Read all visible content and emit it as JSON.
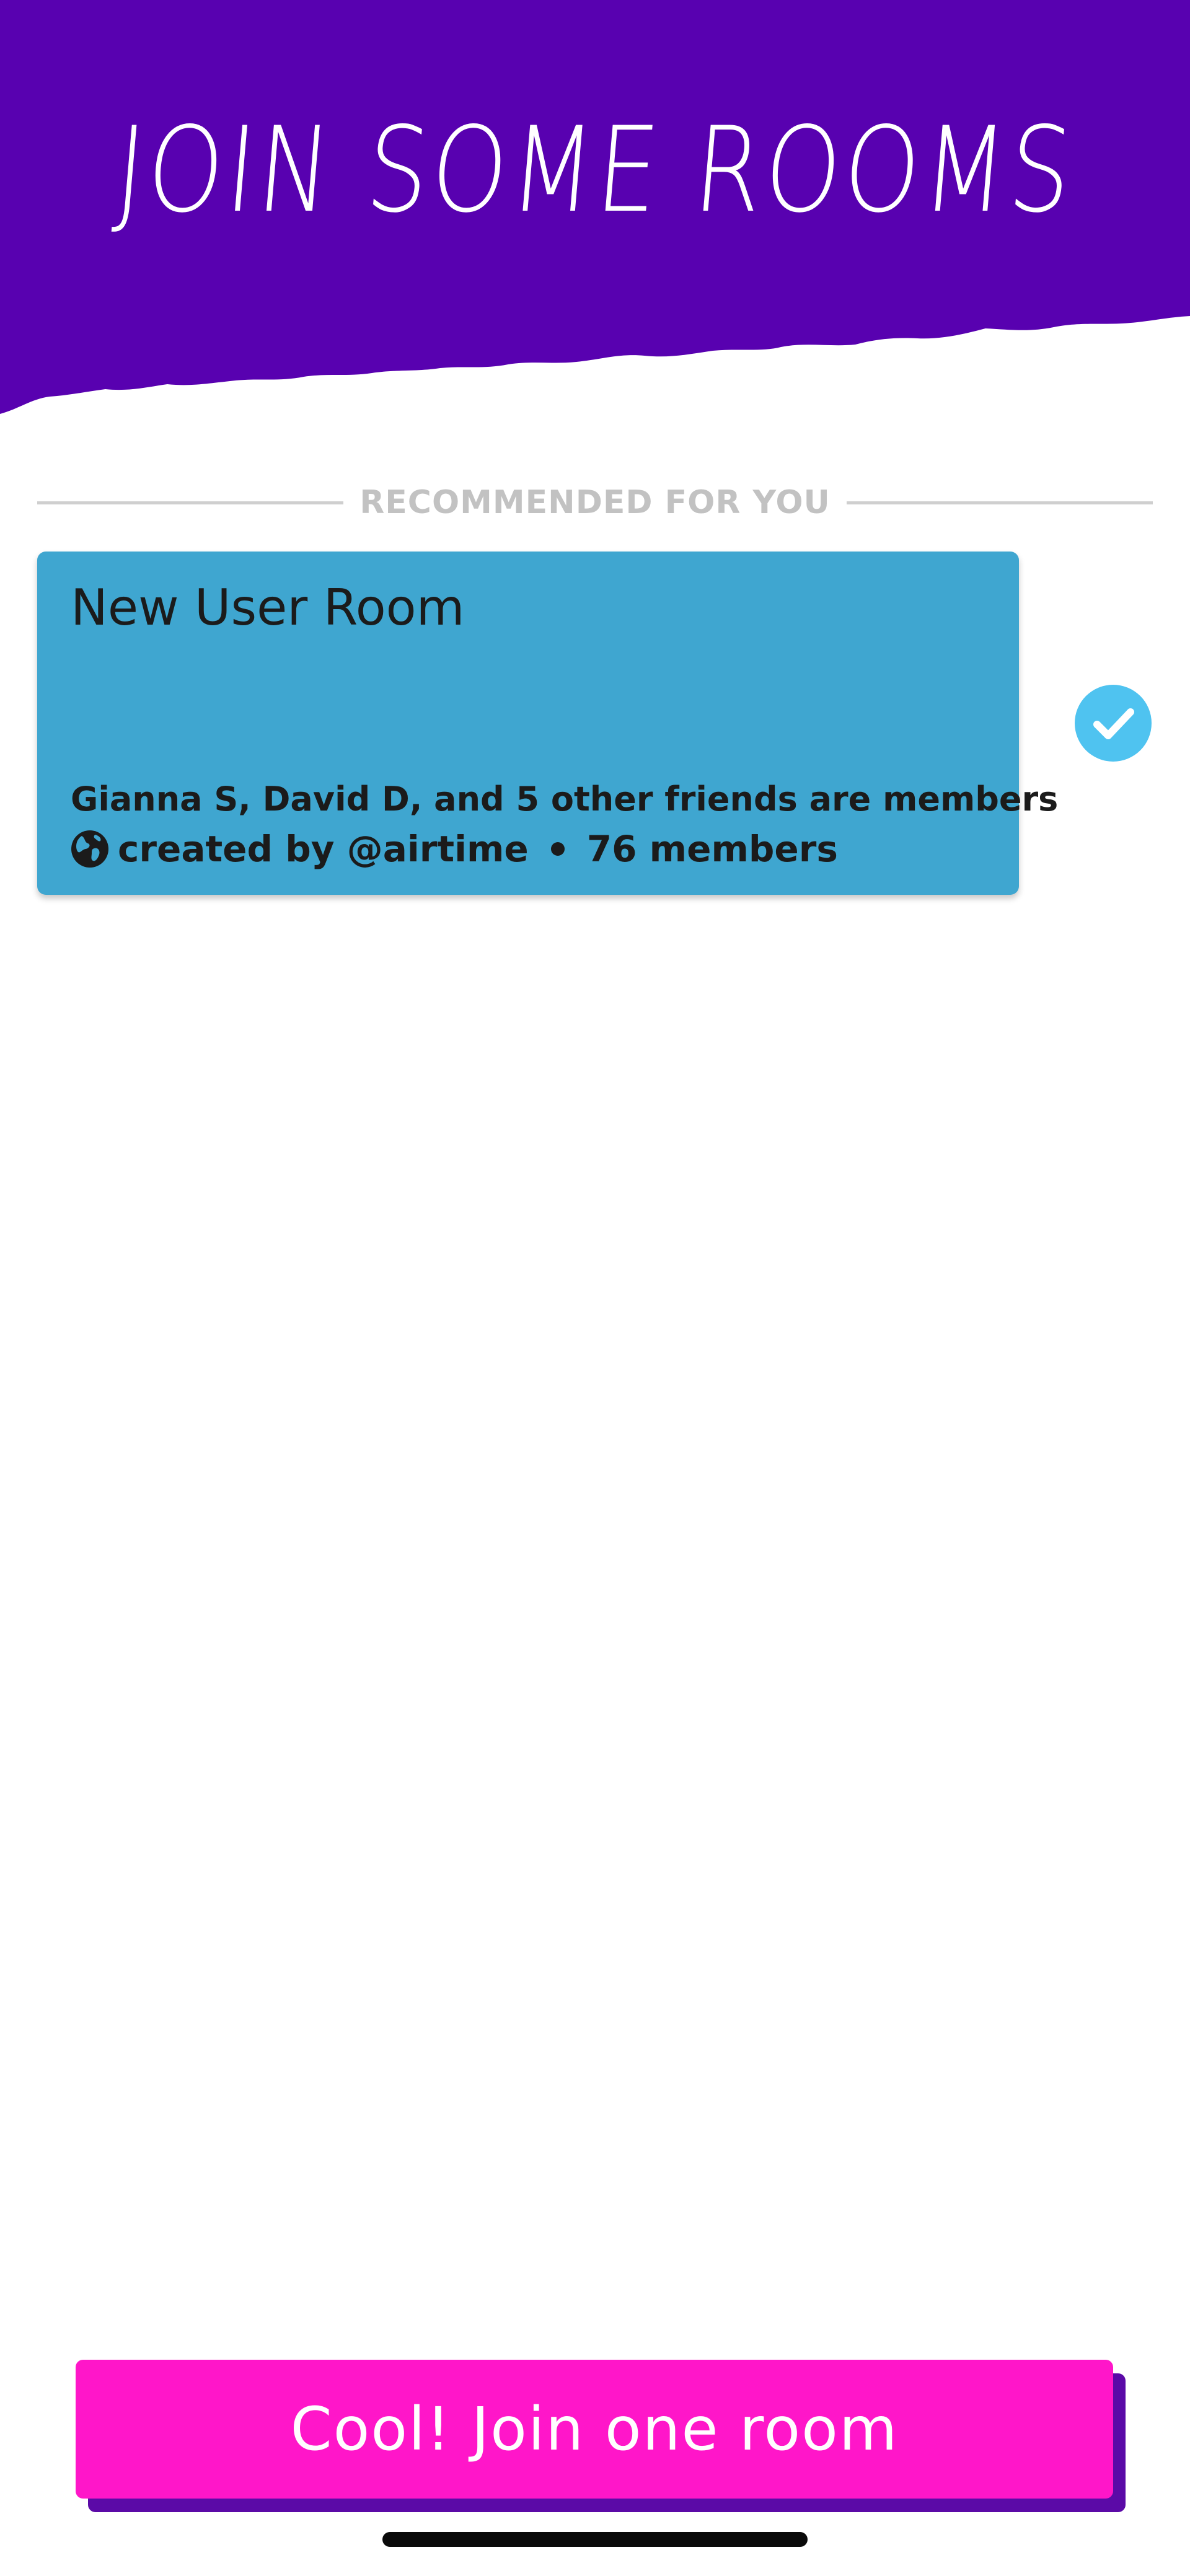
{
  "header": {
    "title": "JOIN SOME ROOMS",
    "background_color": "#5801b0"
  },
  "section": {
    "label": "RECOMMENDED FOR YOU"
  },
  "room": {
    "name": "New User Room",
    "friends_members": "Gianna S, David D, and 5 other friends are members",
    "created_by": "created by @airtime",
    "member_count": "76 members",
    "card_color": "#3fa6d0",
    "selected": true,
    "globe_icon": "globe-icon",
    "check_icon": "check-icon"
  },
  "cta": {
    "label": "Cool! Join one room",
    "color": "#ff16c9",
    "shadow_color": "#5b0aa7"
  }
}
